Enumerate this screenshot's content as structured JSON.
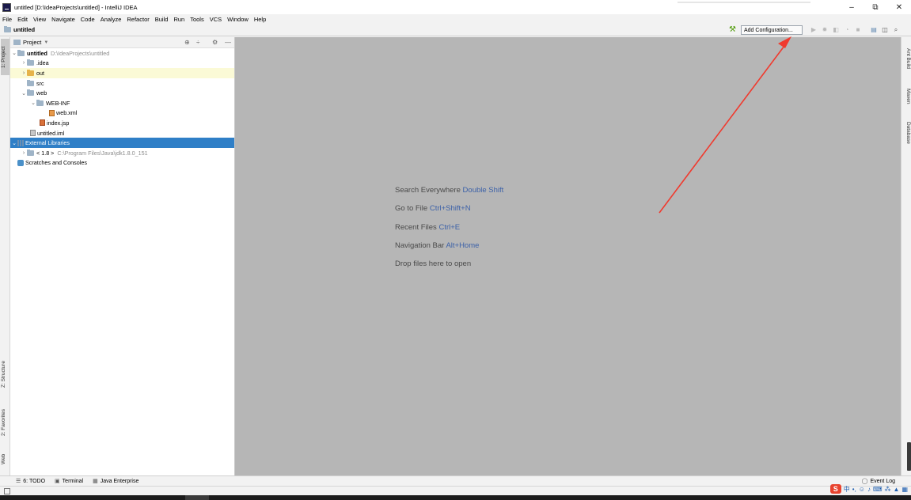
{
  "window": {
    "title": "untitled [D:\\IdeaProjects\\untitled] - IntelliJ IDEA",
    "controls": {
      "minimize": "–",
      "maximize": "⧉",
      "close": "✕"
    }
  },
  "menu": [
    "File",
    "Edit",
    "View",
    "Navigate",
    "Code",
    "Analyze",
    "Refactor",
    "Build",
    "Run",
    "Tools",
    "VCS",
    "Window",
    "Help"
  ],
  "navbar": {
    "breadcrumb": "untitled",
    "add_configuration_label": "Add Configuration..."
  },
  "left_stripe": {
    "project_tab": "1: Project",
    "structure_tab": "Z: Structure",
    "favorites_tab": "2: Favorites",
    "web_tab": "Web"
  },
  "right_stripe": {
    "ant_tab": "Ant Build",
    "maven_tab": "Maven",
    "database_tab": "Database"
  },
  "project_panel": {
    "header_label": "Project",
    "tree": [
      {
        "label": "untitled",
        "hint": "D:\\IdeaProjects\\untitled"
      },
      {
        "label": ".idea"
      },
      {
        "label": "out"
      },
      {
        "label": "src"
      },
      {
        "label": "web"
      },
      {
        "label": "WEB-INF"
      },
      {
        "label": "web.xml"
      },
      {
        "label": "index.jsp"
      },
      {
        "label": "untitled.iml"
      },
      {
        "label": "External Libraries"
      },
      {
        "label": "< 1.8 >",
        "hint": "C:\\Program Files\\Java\\jdk1.8.0_151"
      },
      {
        "label": "Scratches and Consoles"
      }
    ]
  },
  "editor": {
    "hints": [
      {
        "text": "Search Everywhere",
        "shortcut": "Double Shift"
      },
      {
        "text": "Go to File",
        "shortcut": "Ctrl+Shift+N"
      },
      {
        "text": "Recent Files",
        "shortcut": "Ctrl+E"
      },
      {
        "text": "Navigation Bar",
        "shortcut": "Alt+Home"
      },
      {
        "text": "Drop files here to open",
        "shortcut": ""
      }
    ]
  },
  "bottom_tools": {
    "todo": "6: TODO",
    "terminal": "Terminal",
    "java_enterprise": "Java Enterprise",
    "event_log": "Event Log"
  },
  "tray": {
    "ime_logo": "S",
    "ime_lang": "中"
  },
  "colors": {
    "selection": "#2f7fc7",
    "editor_bg": "#b6b6b6",
    "shortcut": "#3c61a8",
    "annotation_arrow": "#f03a2e"
  }
}
